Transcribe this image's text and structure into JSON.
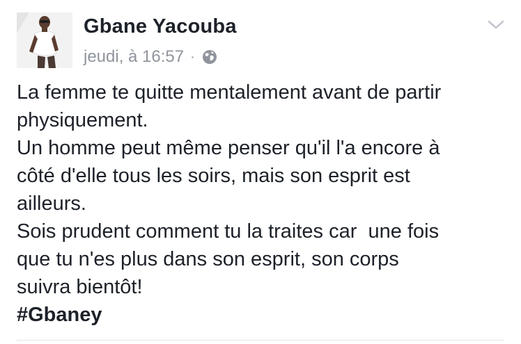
{
  "post": {
    "author_name": "Gbane Yacouba",
    "timestamp": "jeudi, à 16:57",
    "separator": "·",
    "privacy_icon": "globe-icon",
    "menu_icon": "chevron-down-icon",
    "text_lines": [
      "La femme te quitte mentalement avant de partir",
      "physiquement.",
      "Un homme peut même penser qu'il l'a encore à",
      "côté d'elle tous les soirs, mais son esprit est",
      "ailleurs.",
      "Sois prudent comment tu la traites car  une fois",
      "que tu n'es plus dans son esprit, son corps",
      "suivra bientôt!"
    ],
    "hashtag": "#Gbaney"
  },
  "colors": {
    "text": "#1d2129",
    "meta": "#90949c",
    "divider": "#e5e5e5"
  }
}
